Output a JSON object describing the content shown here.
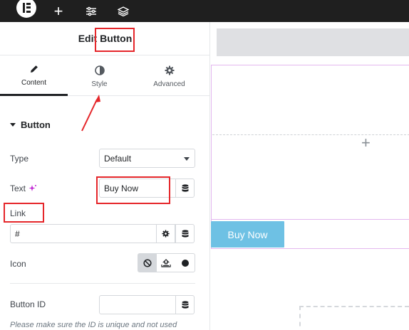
{
  "topbar": {
    "icons": [
      "elementor-logo-icon",
      "plus-icon",
      "sliders-icon",
      "layers-icon"
    ]
  },
  "panel": {
    "header_word1": "Edit",
    "header_word2": "Button",
    "tabs": [
      {
        "label": "Content",
        "icon": "pencil-icon",
        "active": true
      },
      {
        "label": "Style",
        "icon": "half-circle-icon",
        "active": false
      },
      {
        "label": "Advanced",
        "icon": "gear-icon",
        "active": false
      }
    ],
    "section": {
      "title": "Button",
      "type_label": "Type",
      "type_value": "Default",
      "text_label": "Text",
      "text_value": "Buy Now",
      "link_label": "Link",
      "link_value": "#",
      "icon_label": "Icon",
      "button_id_label": "Button ID",
      "button_id_value": "",
      "note": "Please make sure the ID is unique and not used"
    }
  },
  "canvas": {
    "button_label": "Buy Now",
    "add_symbol": "+"
  },
  "colors": {
    "topbar": "#1f1f1f",
    "button_bg": "#6ec1e4",
    "highlight": "#e5262a",
    "section_border": "#e3b7ef"
  }
}
